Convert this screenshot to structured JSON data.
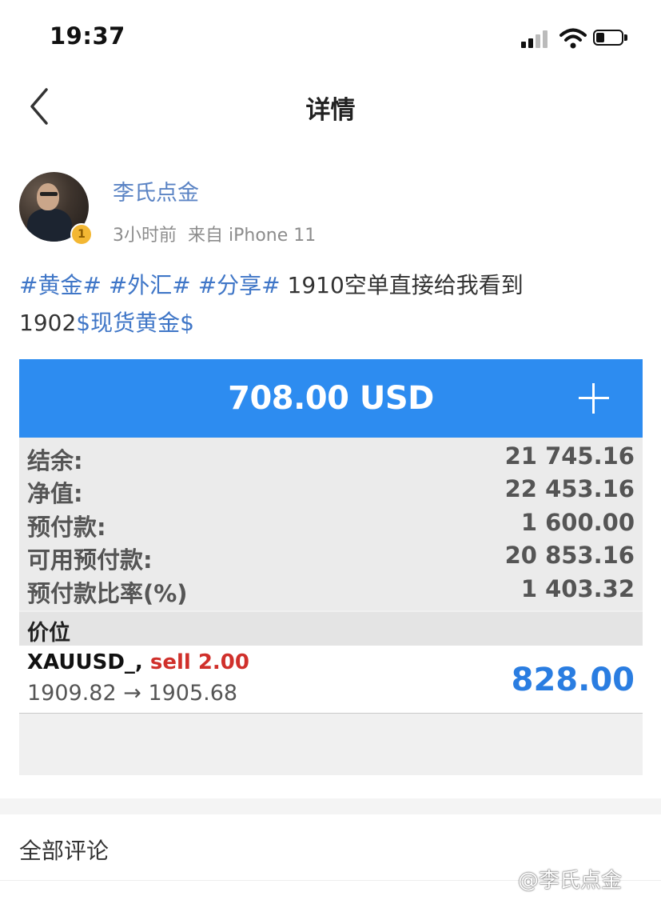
{
  "status_bar": {
    "time": "19:37"
  },
  "nav": {
    "title": "详情"
  },
  "post": {
    "author": "李氏点金",
    "badge_level": "1",
    "time_ago": "3小时前",
    "source": "来自 iPhone 11",
    "text": {
      "tags": [
        "#黄金#",
        "#外汇#",
        "#分享#"
      ],
      "body": " 1910空单直接给我看到",
      "line2_number": "1902",
      "stock_tag": "$现货黄金$"
    }
  },
  "trade_card": {
    "header_amount": "708.00 USD",
    "rows": [
      {
        "label": "结余:",
        "value": "21 745.16"
      },
      {
        "label": "净值:",
        "value": "22 453.16"
      },
      {
        "label": "预付款:",
        "value": "1 600.00"
      },
      {
        "label": "可用预付款:",
        "value": "20 853.16"
      },
      {
        "label": "预付款比率(%)",
        "value": "1 403.32"
      }
    ],
    "section_label": "价位",
    "position": {
      "symbol": "XAUUSD_,",
      "action": "sell 2.00",
      "price_range": "1909.82 → 1905.68",
      "profit": "828.00"
    },
    "colors": {
      "header": "#2d8cf0",
      "sell": "#d0302b",
      "profit": "#2a7de1"
    }
  },
  "comments": {
    "title": "全部评论"
  },
  "watermark": "@李氏点金"
}
